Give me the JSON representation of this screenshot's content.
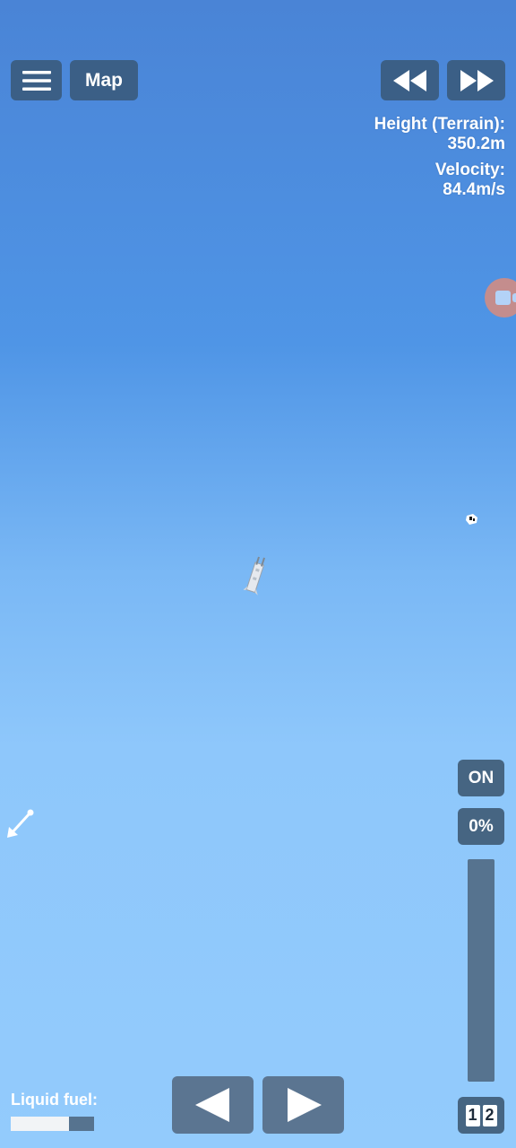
{
  "top_bar": {
    "menu_icon": "hamburger-menu-icon",
    "map_label": "Map",
    "rewind_icon": "rewind-icon",
    "fast_forward_icon": "fast-forward-icon"
  },
  "telemetry": {
    "height_label": "Height (Terrain):",
    "height_value": "350.2m",
    "velocity_label": "Velocity:",
    "velocity_value": "84.4m/s"
  },
  "controls": {
    "sas_label": "ON",
    "throttle_label": "0%",
    "throttle_level": 0
  },
  "fuel": {
    "label": "Liquid fuel:",
    "level": 0.7
  },
  "stage": {
    "prev_icon": "left-triangle-icon",
    "next_icon": "right-triangle-icon",
    "digits": [
      "1",
      "2"
    ]
  },
  "colors": {
    "button_bg": "#3b5f86",
    "track_bg": "#56738f",
    "sky_top": "#4a84d6",
    "sky_bottom": "#93cbfc"
  }
}
